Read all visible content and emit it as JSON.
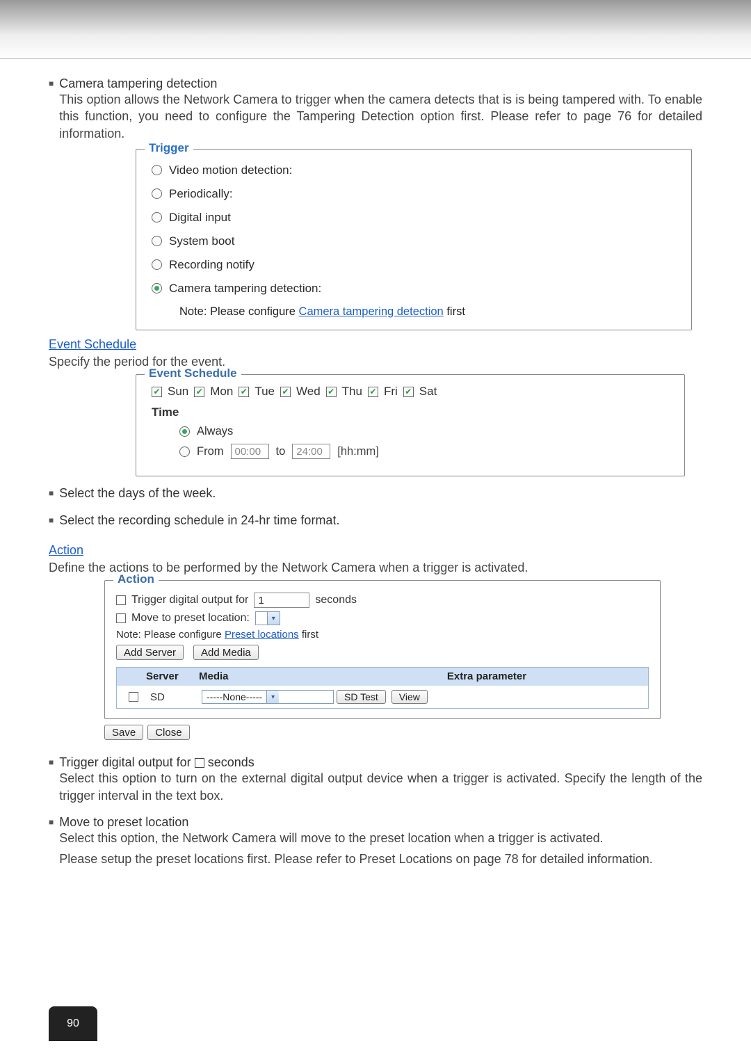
{
  "page_number": "90",
  "intro": {
    "bullet_title": "Camera tampering detection",
    "desc": "This option allows the Network Camera to trigger when the camera detects that is is being tampered with. To enable this function, you need to configure the Tampering Detection option first. Please refer to page 76 for detailed information."
  },
  "trigger_panel": {
    "legend": "Trigger",
    "options": {
      "video": "Video motion detection:",
      "periodically": "Periodically:",
      "digital_input": "Digital input",
      "system_boot": "System boot",
      "recording_notify": "Recording notify",
      "camera_tamper": "Camera tampering detection:"
    },
    "note_prefix": "Note: Please configure ",
    "note_link": "Camera tampering detection",
    "note_suffix": " first"
  },
  "event_schedule": {
    "heading": "Event Schedule",
    "subtext": "Specify the period for the event.",
    "legend": "Event Schedule",
    "days": [
      "Sun",
      "Mon",
      "Tue",
      "Wed",
      "Thu",
      "Fri",
      "Sat"
    ],
    "time_label": "Time",
    "always": "Always",
    "from_label": "From",
    "from_value": "00:00",
    "to_label": "to",
    "to_value": "24:00",
    "hhmm": "[hh:mm]"
  },
  "schedule_notes": {
    "b1": "Select the days of the week.",
    "b2": "Select the recording schedule in 24-hr time format."
  },
  "action": {
    "heading": "Action",
    "subtext": "Define the actions to be performed by the Network Camera when a trigger is activated.",
    "legend": "Action",
    "trigger_do_label": "Trigger digital output for",
    "trigger_do_value": "1",
    "trigger_do_unit": "seconds",
    "move_label": "Move to preset location:",
    "note_prefix": "Note: Please configure ",
    "note_link": "Preset locations",
    "note_suffix": " first",
    "add_server": "Add Server",
    "add_media": "Add Media",
    "th_server": "Server",
    "th_media": "Media",
    "th_extra": "Extra parameter",
    "row_server": "SD",
    "row_media": "-----None-----",
    "row_btn1": "SD Test",
    "row_btn2": "View",
    "save": "Save",
    "close": "Close"
  },
  "action_notes": {
    "b1_prefix": "Trigger digital output for ",
    "b1_suffix": " seconds",
    "b1_desc": "Select this option to turn on the external digital output device when a trigger is activated. Specify the length of the trigger interval in the text box.",
    "b2_title": "Move to preset location",
    "b2_line1": "Select this option, the Network Camera will move to the preset location when a trigger is activated.",
    "b2_line2": "Please setup the preset locations first. Please refer to Preset Locations on page 78 for detailed information."
  }
}
